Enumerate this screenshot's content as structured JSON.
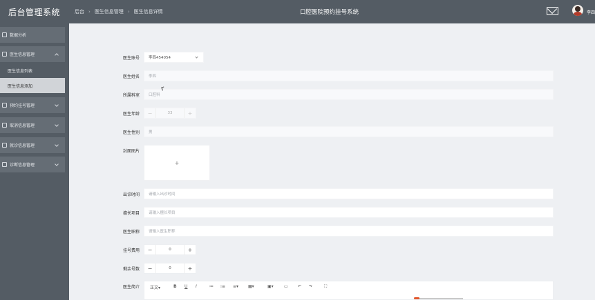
{
  "app": {
    "title": "后台管理系统",
    "system_name": "口腔医院预约挂号系统",
    "user": "李四"
  },
  "breadcrumb": [
    "后台",
    "医生信息管理",
    "医生信息详情"
  ],
  "sidebar": {
    "items": [
      {
        "label": "数据分析"
      },
      {
        "label": "医生信息管理"
      },
      {
        "label": "预约挂号管理"
      },
      {
        "label": "取消信息管理"
      },
      {
        "label": "就诊信息管理"
      },
      {
        "label": "诊断信息管理"
      }
    ],
    "subitems": [
      {
        "label": "医生信息列表"
      },
      {
        "label": "医生信息添加"
      }
    ]
  },
  "form": {
    "doctor_id": {
      "label": "医生账号",
      "value": "李四454054"
    },
    "doctor_name": {
      "label": "医生姓名",
      "value": "李四"
    },
    "department": {
      "label": "所属科室",
      "value": "口腔科"
    },
    "age": {
      "label": "医生年龄",
      "value": "33"
    },
    "gender": {
      "label": "医生性别",
      "value": "男"
    },
    "cover": {
      "label": "封面图片",
      "button": "+"
    },
    "hours": {
      "label": "出诊时间",
      "placeholder": "请输入出诊时间"
    },
    "items": {
      "label": "擅长项目",
      "placeholder": "请输入擅长项目"
    },
    "title": {
      "label": "医生职称",
      "placeholder": "请输入医生职称"
    },
    "fee": {
      "label": "挂号费用",
      "value": "0",
      "minus": "−",
      "plus": "+"
    },
    "remaining": {
      "label": "剩余号数",
      "value": "0",
      "minus": "−",
      "plus": "+"
    },
    "intro": {
      "label": "医生简介"
    }
  },
  "editor_toolbar": [
    "正文▾",
    "B",
    "U",
    "I",
    "≔",
    "⁝≡",
    "≡▾",
    "▦▾",
    "▣▾",
    "▭",
    "↶",
    "↷",
    "⛶"
  ]
}
